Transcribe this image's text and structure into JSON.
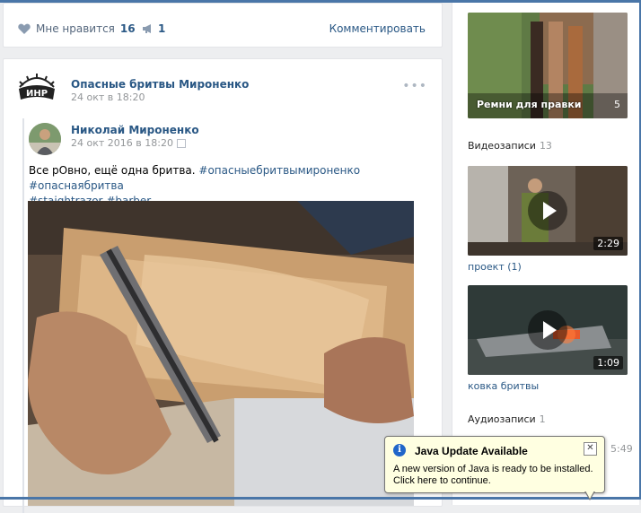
{
  "post1": {
    "like_label": "Мне нравится",
    "like_count": "16",
    "share_count": "1",
    "comment_label": "Комментировать"
  },
  "post2": {
    "group_name": "Опасные бритвы Мироненко",
    "group_logo_text": "ИНР",
    "date": "24 окт в 18:20",
    "more": "•••",
    "repost": {
      "author": "Николай Мироненко",
      "date": "24 окт 2016 в 18:20",
      "text_plain": "Все рОвно, ещё одна бритва.",
      "tags": [
        "#опасныебритвымироненко",
        "#опаснаябритва",
        "#staightrazor",
        "#barber"
      ]
    }
  },
  "sidebar": {
    "album": {
      "title": "Ремни для правки",
      "count": "5"
    },
    "videos": {
      "title": "Видеозаписи",
      "count": "13",
      "items": [
        {
          "title": "проект (1)",
          "duration": "2:29"
        },
        {
          "title": "ковка бритвы",
          "duration": "1:09"
        }
      ]
    },
    "audio": {
      "title": "Аудиозаписи",
      "count": "1",
      "time": "5:49"
    }
  },
  "java_balloon": {
    "title": "Java Update Available",
    "message_line1": "A new version of Java is ready to be installed.",
    "message_line2": "Click here to continue."
  }
}
